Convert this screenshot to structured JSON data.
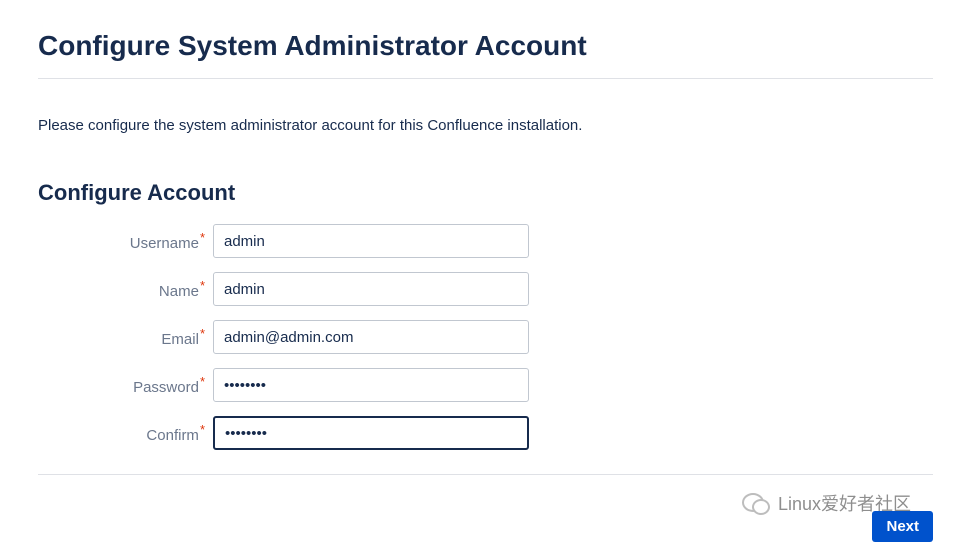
{
  "page": {
    "title": "Configure System Administrator Account",
    "intro": "Please configure the system administrator account for this Confluence installation."
  },
  "section": {
    "title": "Configure Account"
  },
  "form": {
    "username": {
      "label": "Username",
      "value": "admin"
    },
    "name": {
      "label": "Name",
      "value": "admin"
    },
    "email": {
      "label": "Email",
      "value": "admin@admin.com"
    },
    "password": {
      "label": "Password",
      "value": "••••••••"
    },
    "confirm": {
      "label": "Confirm",
      "value": "••••••••"
    },
    "required_marker": "*"
  },
  "actions": {
    "next": "Next"
  },
  "watermark": {
    "text": "Linux爱好者社区"
  }
}
